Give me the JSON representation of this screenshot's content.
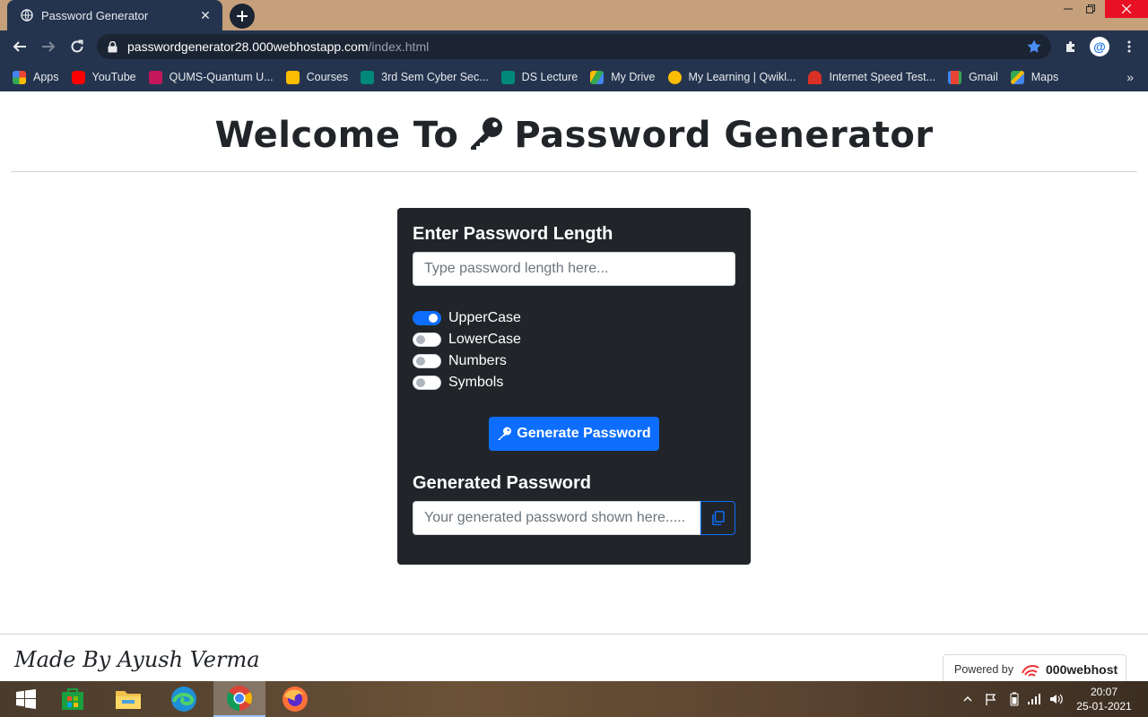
{
  "browser": {
    "tab_title": "Password Generator",
    "url_host": "passwordgenerator28.000webhostapp.com",
    "url_path": "/index.html",
    "bookmarks": [
      {
        "label": "Apps",
        "color": "#4285f4"
      },
      {
        "label": "YouTube",
        "color": "#ff0000"
      },
      {
        "label": "QUMS-Quantum U...",
        "color": "#c2185b"
      },
      {
        "label": "Courses",
        "color": "#fbbc04"
      },
      {
        "label": "3rd Sem Cyber Sec...",
        "color": "#00897b"
      },
      {
        "label": "DS Lecture",
        "color": "#00897b"
      },
      {
        "label": "My Drive",
        "color": "#34a853"
      },
      {
        "label": "My Learning | Qwikl...",
        "color": "#fbbc04"
      },
      {
        "label": "Internet Speed Test...",
        "color": "#d93025"
      },
      {
        "label": "Gmail",
        "color": "#ea4335"
      },
      {
        "label": "Maps",
        "color": "#34a853"
      }
    ],
    "more_bookmarks": "»"
  },
  "page": {
    "heading_before": "Welcome To",
    "heading_after": "Password Generator",
    "length_label": "Enter Password Length",
    "length_placeholder": "Type password length here...",
    "options": [
      {
        "label": "UpperCase",
        "checked": true
      },
      {
        "label": "LowerCase",
        "checked": false
      },
      {
        "label": "Numbers",
        "checked": false
      },
      {
        "label": "Symbols",
        "checked": false
      }
    ],
    "generate_label": "Generate Password",
    "generated_label": "Generated Password",
    "generated_placeholder": "Your generated password shown here.....",
    "footer_text": "Made By Ayush Verma",
    "powered_by": "Powered by",
    "host_brand": "000webhost"
  },
  "taskbar": {
    "time": "20:07",
    "date": "25-01-2021"
  },
  "colors": {
    "card_bg": "#212529",
    "primary": "#0d6efd",
    "chrome_bg": "#24344f"
  }
}
